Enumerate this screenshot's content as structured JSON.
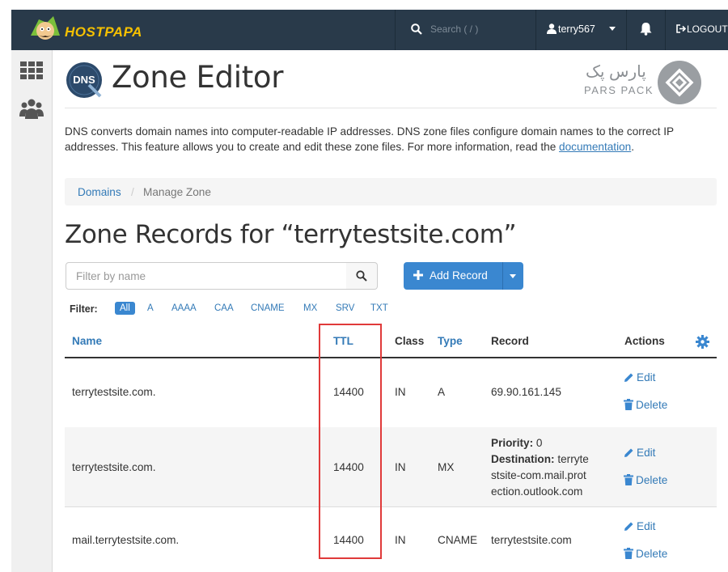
{
  "topbar": {
    "brand": "HOSTPAPA",
    "search_placeholder": "Search ( / )",
    "username": "terry567",
    "logout_label": "LOGOUT"
  },
  "page": {
    "dns_badge": "DNS",
    "title": "Zone Editor",
    "watermark_fa": "پارس پک",
    "watermark_en": "PARS PACK",
    "description_pre": "DNS converts domain names into computer-readable IP addresses. DNS zone files configure domain names to the correct IP addresses. This feature allows you to create and edit these zone files. For more information, read the ",
    "description_link": "documentation",
    "description_post": "."
  },
  "breadcrumb": {
    "domains": "Domains",
    "separator": "/",
    "current": "Manage Zone"
  },
  "zone": {
    "heading": "Zone Records for “terrytestsite.com”",
    "filter_placeholder": "Filter by name",
    "add_record_label": "Add Record",
    "filter_label": "Filter:",
    "filter_types": [
      "All",
      "A",
      "AAAA",
      "CAA",
      "CNAME",
      "MX",
      "SRV",
      "TXT"
    ]
  },
  "table": {
    "headers": {
      "name": "Name",
      "ttl": "TTL",
      "class": "Class",
      "type": "Type",
      "record": "Record",
      "actions": "Actions"
    },
    "edit_label": "Edit",
    "delete_label": "Delete",
    "rows": [
      {
        "name": "terrytestsite.com.",
        "ttl": "14400",
        "class": "IN",
        "type": "A",
        "record": "69.90.161.145"
      },
      {
        "name": "terrytestsite.com.",
        "ttl": "14400",
        "class": "IN",
        "type": "MX",
        "priority_label": "Priority:",
        "priority_value": "0",
        "destination_label": "Destination:",
        "destination_line1": "terryte",
        "destination_line2": "stsite-com.mail.prot",
        "destination_line3": "ection.outlook.com"
      },
      {
        "name": "mail.terrytestsite.com.",
        "ttl": "14400",
        "class": "IN",
        "type": "CNAME",
        "record": "terrytestsite.com"
      }
    ]
  },
  "colors": {
    "topbar_bg": "#293a4a",
    "link": "#337ab7",
    "primary_button": "#3a87d0",
    "highlight_box": "#e03a3a"
  }
}
